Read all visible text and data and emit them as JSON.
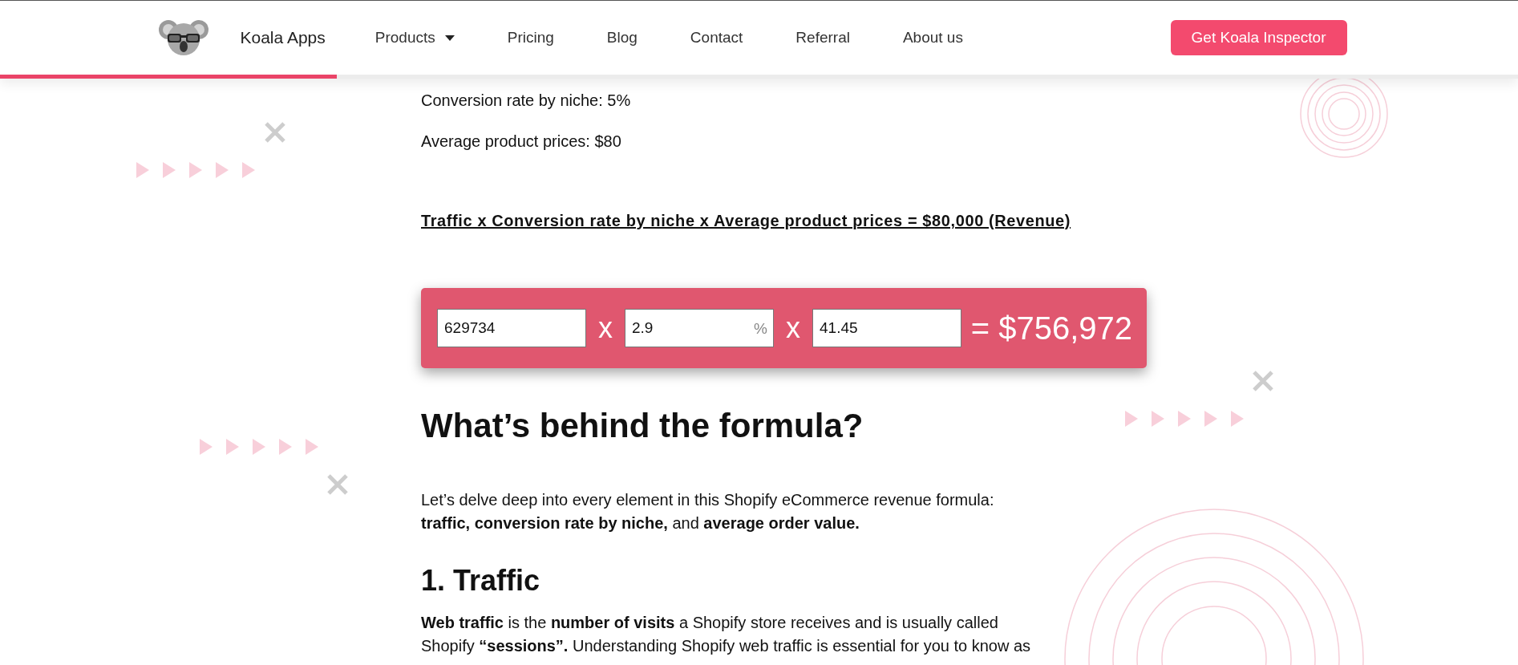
{
  "header": {
    "logo_text": "Koala Apps",
    "nav": [
      {
        "label": "Products",
        "dropdown": true
      },
      {
        "label": "Pricing",
        "dropdown": false
      },
      {
        "label": "Blog",
        "dropdown": false
      },
      {
        "label": "Contact",
        "dropdown": false
      },
      {
        "label": "Referral",
        "dropdown": false
      },
      {
        "label": "About us",
        "dropdown": false
      }
    ],
    "cta": "Get Koala Inspector",
    "reading_progress": {
      "level": 0.222
    }
  },
  "content": {
    "stats": [
      "Conversion rate by niche: 5%",
      "Average product prices: $80"
    ],
    "formula": "Traffic x Conversion rate by niche x Average product prices = $80,000 (Revenue)",
    "calculator": {
      "fields": [
        {
          "value": "629734"
        },
        {
          "value": "2.9",
          "unit": "%"
        },
        {
          "value": "41.45"
        }
      ],
      "operators": [
        "x",
        "x"
      ],
      "result": "= $756,972"
    },
    "sections": [
      {
        "heading": "What’s behind the formula?",
        "paragraph": "Let’s delve deep into every element in this Shopify eCommerce revenue formula: **traffic, conversion rate by niche,** and **average order value.**"
      },
      {
        "heading": "1. Traffic",
        "paragraph": "**Web traffic** is the **number of visits** a Shopify store receives and is usually called Shopify **“sessions”.** Understanding Shopify web traffic is essential for you to know as"
      }
    ]
  }
}
